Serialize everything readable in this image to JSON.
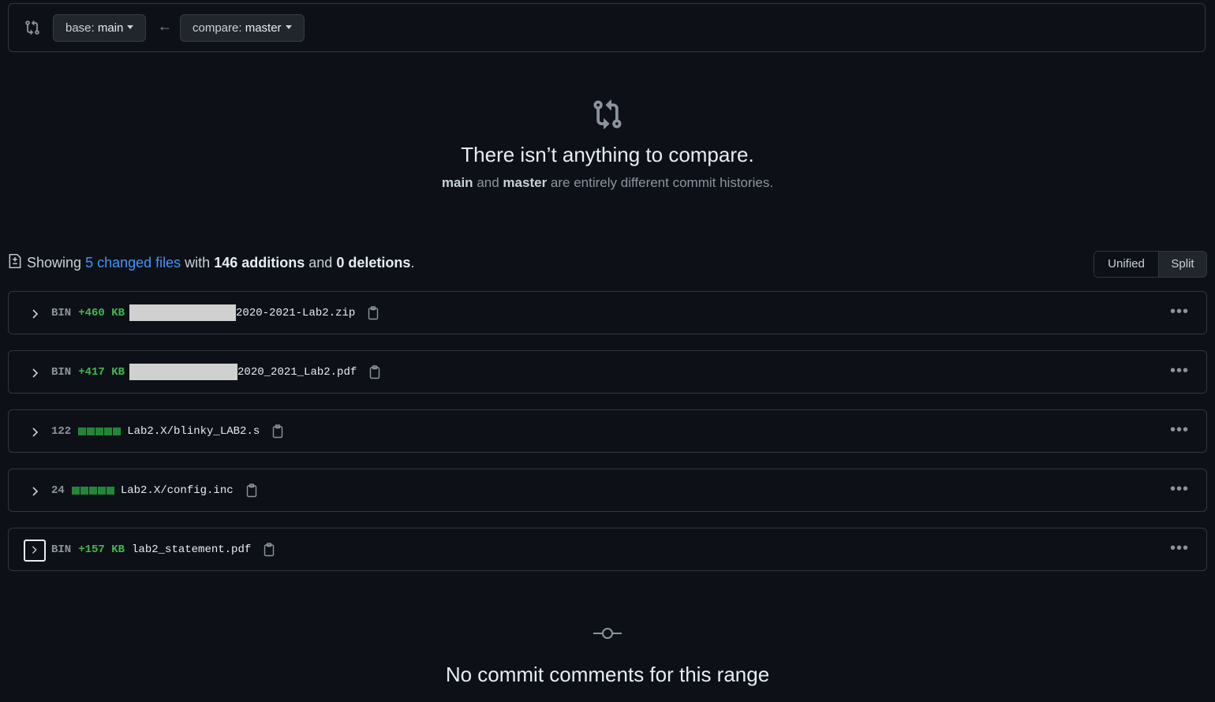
{
  "range": {
    "base_prefix": "base: ",
    "base_branch": "main",
    "compare_prefix": "compare: ",
    "compare_branch": "master"
  },
  "blankslate": {
    "title": "There isn’t anything to compare.",
    "branch_a": "main",
    "and_text": "and",
    "branch_b": "master",
    "rest": "are entirely different commit histories."
  },
  "toc": {
    "showing": "Showing",
    "changed_files": "5 changed files",
    "with": "with",
    "additions": "146 additions",
    "and": "and",
    "deletions": "0 deletions",
    "period": "."
  },
  "view_toggle": {
    "unified": "Unified",
    "split": "Split",
    "selected": "Split"
  },
  "files": [
    {
      "stat": "BIN",
      "size": "+460 KB",
      "name": "2020-2021-Lab2.zip",
      "redacted": true
    },
    {
      "stat": "BIN",
      "size": "+417 KB",
      "name": "2020_2021_Lab2.pdf",
      "redacted": true
    },
    {
      "stat": "122",
      "blocks": 5,
      "name": "Lab2.X/blinky_LAB2.s"
    },
    {
      "stat": "24",
      "blocks": 5,
      "name": "Lab2.X/config.inc"
    },
    {
      "stat": "BIN",
      "size": "+157 KB",
      "name": "lab2_statement.pdf"
    }
  ],
  "comments": {
    "title": "No commit comments for this range"
  },
  "colors": {
    "background": "#0d1117",
    "link": "#4493f8",
    "addition": "#3fb950",
    "diff_block": "#238636",
    "border": "#30363d"
  }
}
